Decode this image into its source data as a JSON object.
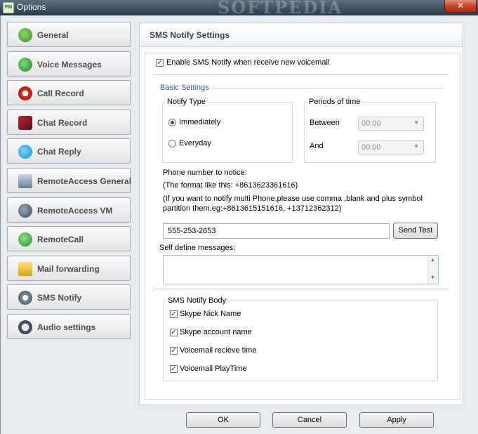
{
  "window": {
    "title": "Options",
    "watermark": "SOFTPEDIA",
    "close_glyph": "✕",
    "app_icon_text": "PM"
  },
  "sidebar": {
    "items": [
      {
        "label": "General",
        "icon": "pm-logo-icon",
        "color": "#3c8d2f"
      },
      {
        "label": "Voice Messages",
        "icon": "voice-messages-icon",
        "color": "#2f8f3a"
      },
      {
        "label": "Call Record",
        "icon": "record-icon",
        "color": "#d22a1a"
      },
      {
        "label": "Chat Record",
        "icon": "chat-record-icon",
        "color": "#8a1c2a"
      },
      {
        "label": "Chat Reply",
        "icon": "chat-reply-icon",
        "color": "#1c8fd2"
      },
      {
        "label": "RemoteAccess General",
        "icon": "remote-access-icon",
        "color": "#6b7f95"
      },
      {
        "label": "RemoteAccess VM",
        "icon": "remote-vm-icon",
        "color": "#4a5a6a"
      },
      {
        "label": "RemoteCall",
        "icon": "remote-call-icon",
        "color": "#3a9a40"
      },
      {
        "label": "Mail forwarding",
        "icon": "mail-forward-icon",
        "color": "#e0b020"
      },
      {
        "label": "SMS Notify",
        "icon": "sms-notify-icon",
        "color": "#5a6a7a"
      },
      {
        "label": "Audio settings",
        "icon": "audio-settings-icon",
        "color": "#4a5a6a"
      }
    ]
  },
  "main": {
    "heading": "SMS Notify Settings",
    "enable_label": "Enable SMS Notify when receive new voicemail",
    "enable_checked": true,
    "basic_settings": "Basic Settings",
    "notify_type": {
      "title": "Notify Type",
      "options": [
        "Immediately",
        "Everyday"
      ],
      "selected": "Immediately"
    },
    "periods": {
      "title": "Periods of time",
      "between_label": "Between",
      "between_value": "00:00",
      "and_label": "And",
      "and_value": "00:00",
      "arrow": "▼"
    },
    "phone": {
      "label": "Phone number to notice:",
      "format_hint": "(The format like this: +8613623361616)",
      "multi_hint_line1": "(If you want to notify multi Phone,please use comma ,blank and plus symbol",
      "multi_hint_line2": "partition them.eg:+8613615151616, +13712362312)",
      "value": "555-253-2653",
      "send_test": "Send Test"
    },
    "self_define": {
      "label": "Self define messages:",
      "value": "",
      "scroll_up": "▲",
      "scroll_down": "▼"
    },
    "body": {
      "title": "SMS Notify Body",
      "items": [
        {
          "label": "Skype Nick Name",
          "checked": true
        },
        {
          "label": "Skype account name",
          "checked": true
        },
        {
          "label": "Voicemail recieve time",
          "checked": true
        },
        {
          "label": "Voicemail PlayTime",
          "checked": true
        }
      ]
    },
    "check_glyph": "✓"
  },
  "footer": {
    "ok": "OK",
    "cancel": "Cancel",
    "apply": "Apply"
  },
  "colors": {
    "group_title": "#3a5a9a"
  }
}
